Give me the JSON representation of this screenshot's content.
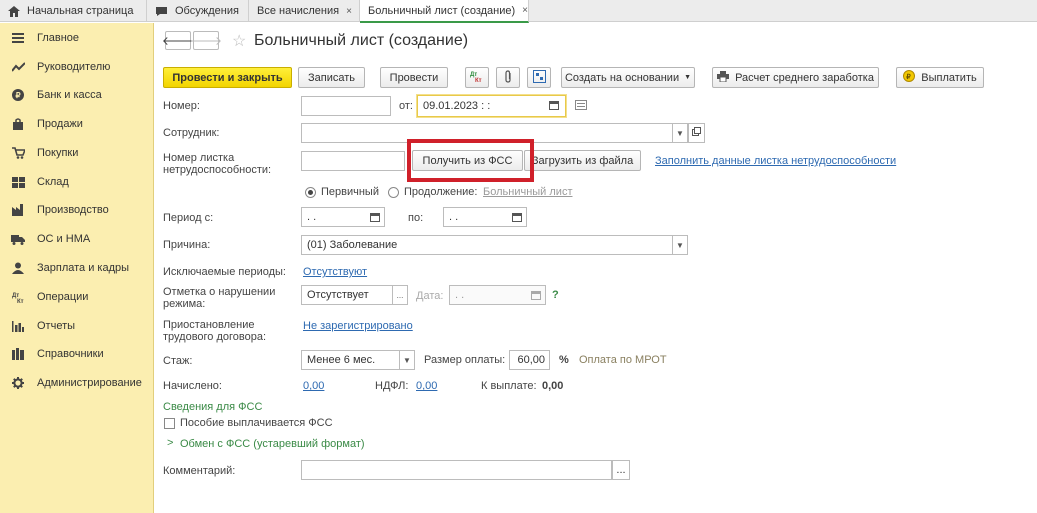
{
  "tabs": [
    {
      "label": "Начальная страница",
      "icon": "home-icon"
    },
    {
      "label": "Обсуждения",
      "icon": "chat-icon"
    },
    {
      "label": "Все начисления",
      "icon": ""
    },
    {
      "label": "Больничный лист (создание)",
      "icon": ""
    }
  ],
  "close_glyph": "×",
  "sidebar": {
    "items": [
      {
        "label": "Главное",
        "icon": "menu-icon"
      },
      {
        "label": "Руководителю",
        "icon": "chart-line-icon"
      },
      {
        "label": "Банк и касса",
        "icon": "coin-icon"
      },
      {
        "label": "Продажи",
        "icon": "bag-icon"
      },
      {
        "label": "Покупки",
        "icon": "cart-icon"
      },
      {
        "label": "Склад",
        "icon": "warehouse-icon"
      },
      {
        "label": "Производство",
        "icon": "factory-icon"
      },
      {
        "label": "ОС и НМА",
        "icon": "truck-icon"
      },
      {
        "label": "Зарплата и кадры",
        "icon": "person-icon"
      },
      {
        "label": "Операции",
        "icon": "debit-credit-icon"
      },
      {
        "label": "Отчеты",
        "icon": "bar-chart-icon"
      },
      {
        "label": "Справочники",
        "icon": "books-icon"
      },
      {
        "label": "Администрирование",
        "icon": "gear-icon"
      }
    ]
  },
  "form": {
    "title": "Больничный лист (создание)",
    "toolbar": {
      "post_close": "Провести и закрыть",
      "save": "Записать",
      "post": "Провести",
      "create_based": "Создать на основании",
      "avg_earnings": "Расчет среднего заработка",
      "pay": "Выплатить"
    },
    "number_label": "Номер:",
    "number_value": "",
    "from_label": "от:",
    "date_value": "09.01.2023   :  :",
    "employee_label": "Сотрудник:",
    "employee_value": "",
    "sheet_number_label": "Номер листка нетрудоспособности:",
    "sheet_number_value": "",
    "get_fss": "Получить из ФСС",
    "load_file": "Загрузить из файла",
    "fill_link": "Заполнить данные листка нетрудоспособности",
    "radio_primary": "Первичный",
    "radio_continuation": "Продолжение:",
    "continuation_link": "Больничный лист",
    "period_label": "Период с:",
    "period_from": " .  .",
    "period_to_label": "по:",
    "period_to": " .  .",
    "reason_label": "Причина:",
    "reason_value": "(01) Заболевание",
    "excluded_label": "Исключаемые периоды:",
    "excluded_value": "Отсутствуют",
    "violation_label": "Отметка о нарушении режима:",
    "violation_value": "Отсутствует",
    "violation_date_label": "Дата:",
    "violation_date_value": " .  .",
    "help_glyph": "?",
    "suspension_label": "Приостановление трудового договора:",
    "suspension_value": "Не зарегистрировано",
    "experience_label": "Стаж:",
    "experience_value": "Менее 6 мес.",
    "pay_size_label": "Размер оплаты:",
    "pay_size_value": "60,00",
    "percent": "%",
    "pay_mrot": "Оплата по МРОТ",
    "accrued_label": "Начислено:",
    "accrued_value": "0,00",
    "ndfl_label": "НДФЛ:",
    "ndfl_value": "0,00",
    "to_pay_label": "К выплате:",
    "to_pay_value": "0,00",
    "fss_section": "Сведения для ФСС",
    "fss_checkbox": "Пособие выплачивается ФСС",
    "fss_exchange": "Обмен с ФСС (устаревший формат)",
    "comment_label": "Комментарий:",
    "comment_value": "",
    "ellipsis": "..."
  },
  "colors": {
    "sidebar_bg": "#fbeeb0",
    "primary_button": "#f2d400",
    "highlight_box": "#d0202a",
    "link": "#2e6ab1",
    "green": "#3a8a46"
  }
}
